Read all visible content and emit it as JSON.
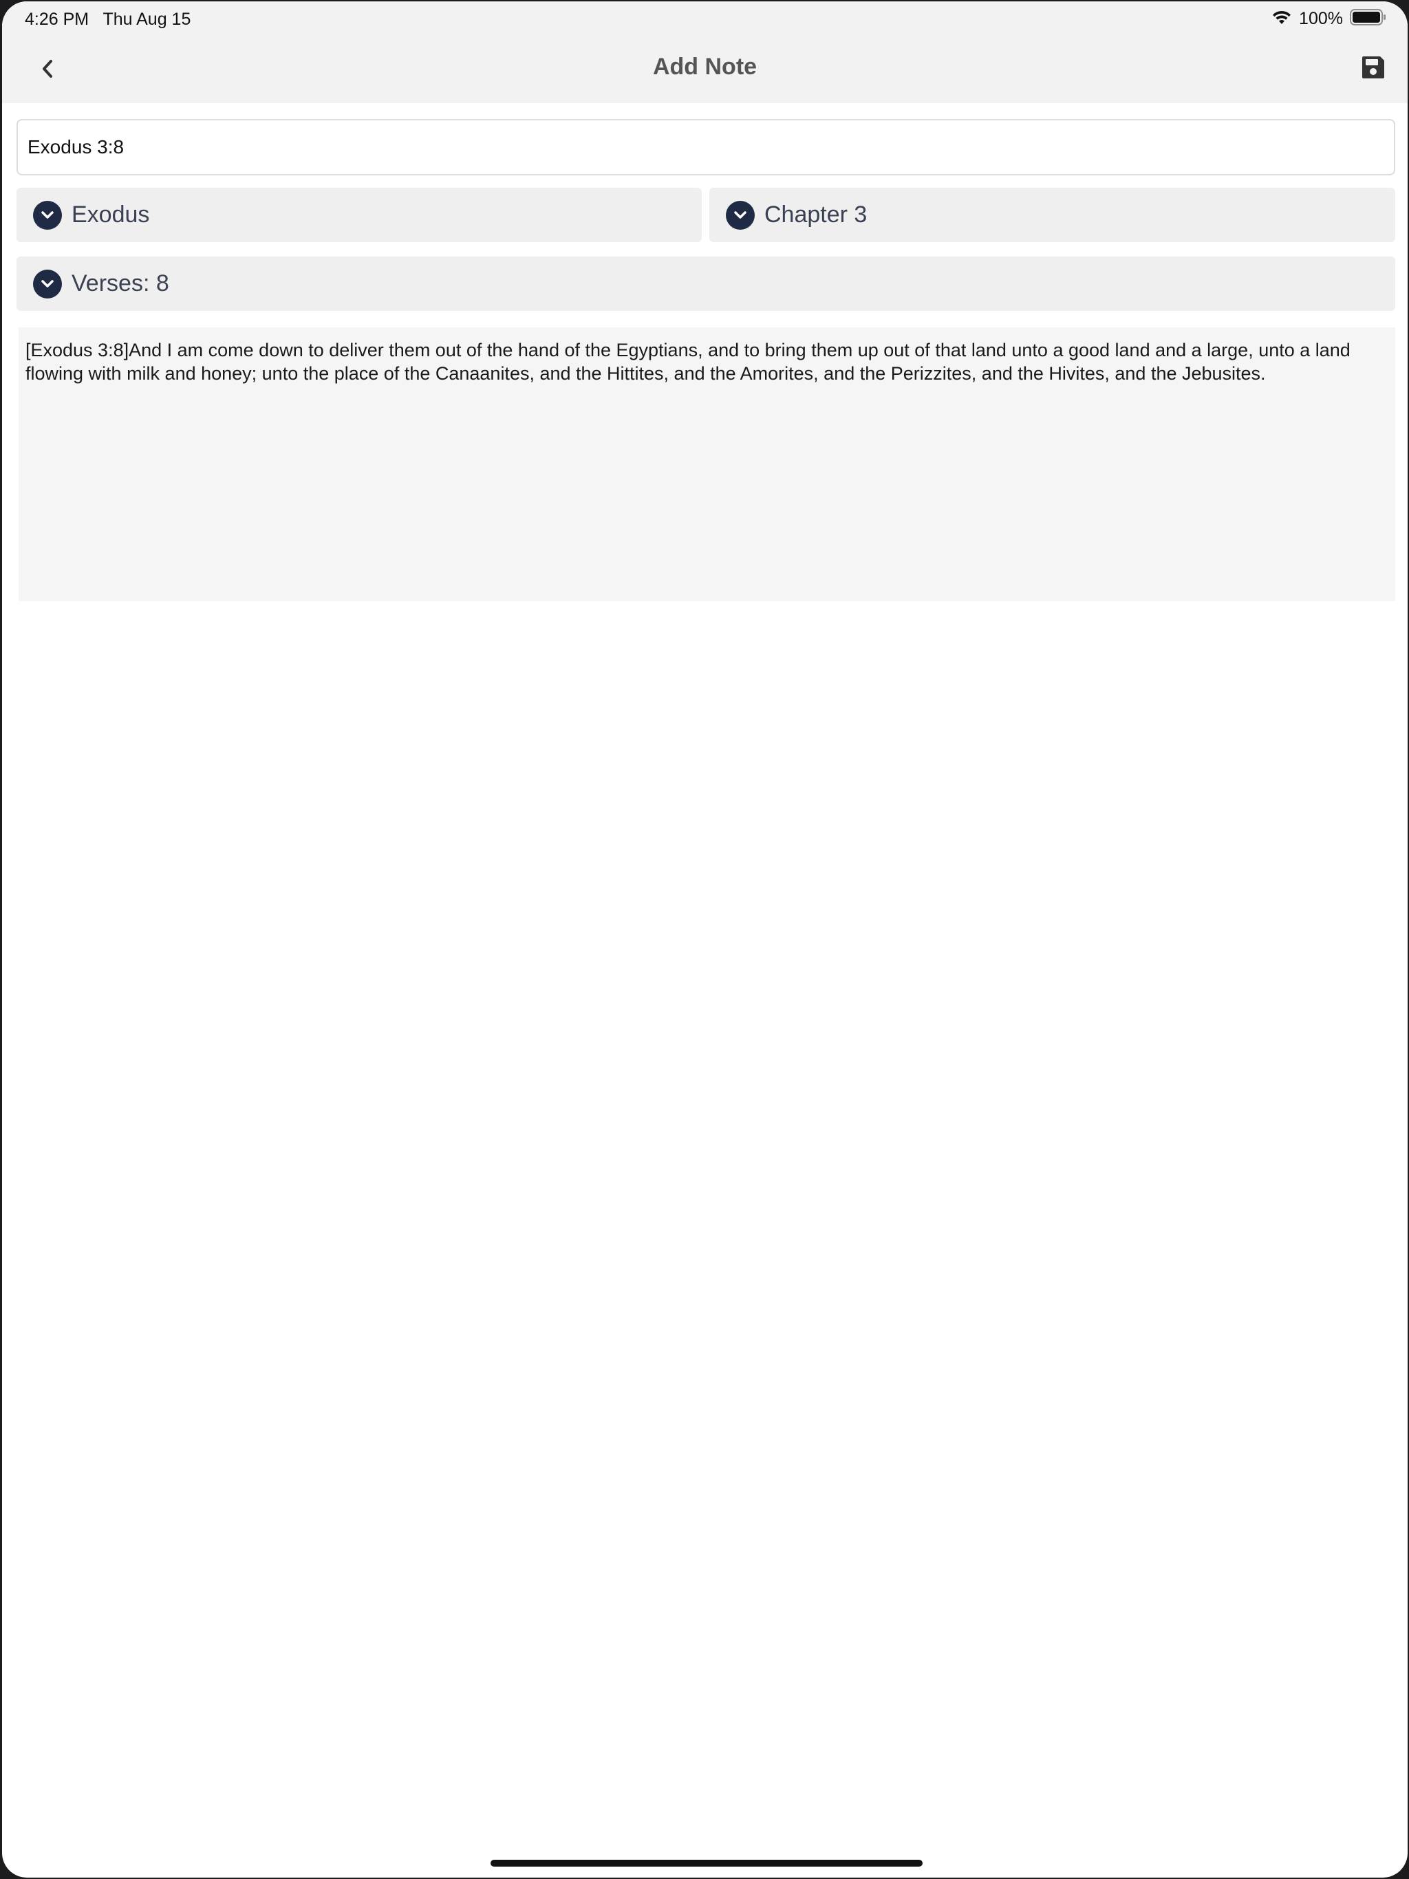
{
  "status_bar": {
    "time_date": "4:26 PM   Thu Aug 15",
    "battery": "100%",
    "wifi_icon": "wifi-icon",
    "battery_icon": "battery-full-icon"
  },
  "nav": {
    "title": "Add Note",
    "back_icon": "chevron-left-icon",
    "save_icon": "save-icon"
  },
  "note": {
    "title_value": "Exodus 3:8"
  },
  "pickers": {
    "book": "Exodus",
    "chapter": "Chapter 3",
    "verses": "Verses: 8",
    "icon": "chevron-down-circle-icon",
    "icon_color": "#1f2a44"
  },
  "verse": {
    "text": "[Exodus 3:8]And I am come down to deliver them out of the hand of the Egyptians, and to bring them up out of that land unto a good land and a large, unto a land flowing with milk and honey; unto the place of the Canaanites, and the Hittites, and the Amorites, and the Perizzites, and the Hivites, and the Jebusites."
  }
}
